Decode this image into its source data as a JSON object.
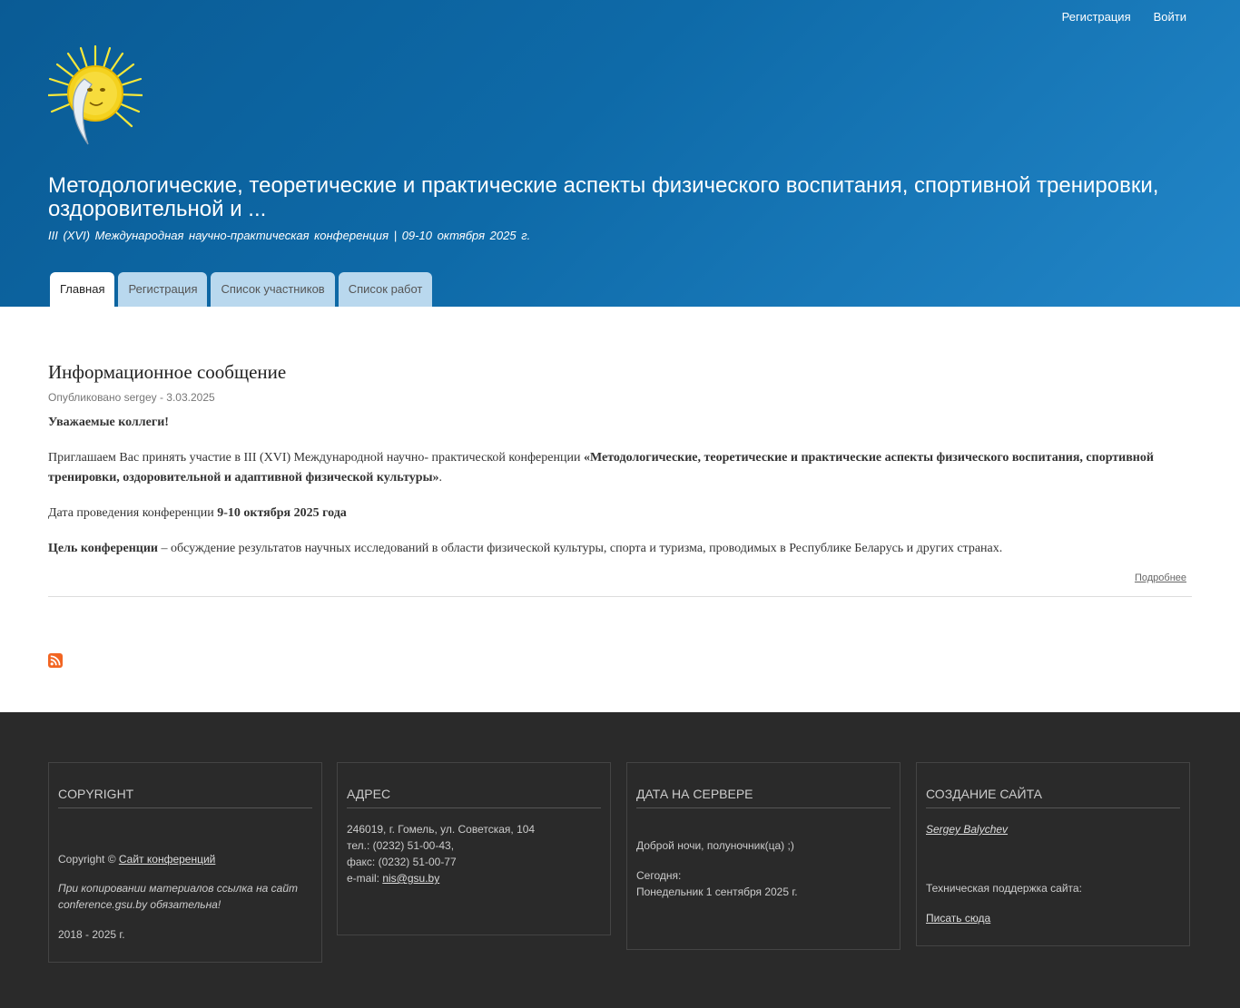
{
  "top_links": {
    "register": "Регистрация",
    "login": "Войти"
  },
  "site": {
    "title": "Методологические, теоретические и практические аспекты физического воспитания, спортивной тренировки, оздоровительной и ...",
    "slogan": "III (XVI) Международная научно-практическая конференция | 09-10 октября 2025 г."
  },
  "tabs": [
    {
      "label": "Главная",
      "active": true
    },
    {
      "label": "Регистрация"
    },
    {
      "label": "Список участников"
    },
    {
      "label": "Список работ"
    }
  ],
  "node": {
    "title": "Информационное сообщение",
    "submitted": "Опубликовано sergey - 3.03.2025",
    "greeting": "Уважаемые коллеги!",
    "invite_text": "Приглашаем Вас принять участие в III (XVI) Международной научно- практической конференции ",
    "invite_bold": "«Методологические, теоретические и практические аспекты физического воспитания, спортивной тренировки, оздоровительной и адаптивной физической культуры»",
    "invite_end": ".",
    "date_text": "Дата проведения конференции ",
    "date_bold": "9-10 октября 2025 года",
    "goal_bold": "Цель конференции",
    "goal_text": " – обсуждение результатов научных исследований в области физической культуры, спорта и туризма, проводимых в Республике Беларусь и других странах.",
    "more": "Подробнее"
  },
  "icons": {
    "rss": "rss-icon",
    "logo": "sun-moon-logo"
  },
  "colors": {
    "header_top": "#0a5b95",
    "header_bottom": "#2286c8",
    "tab_bg": "#b9d8ee",
    "footer_bg": "#2a2a2a",
    "rss": "#f26522"
  },
  "footer": {
    "copyright": {
      "title": "Copyright",
      "line_prefix": "Copyright © ",
      "link": "Сайт конференций",
      "note": "При копировании материалов ссылка на сайт conference.gsu.by обязательна!",
      "years": "2018 - 2025 г."
    },
    "address": {
      "title": "Адрес",
      "street": "246019, г. Гомель, ул. Советская, 104",
      "phone": "тел.: (0232) 51-00-43,",
      "fax": "факс: (0232) 51-00-77",
      "email_label": "e-mail: ",
      "email": "nis@gsu.by"
    },
    "server_date": {
      "title": "Дата на сервере",
      "greeting": "Доброй ночи, полуночник(ца) ;)",
      "today_label": "Сегодня:",
      "today_value": "Понедельник 1 сентября 2025 г."
    },
    "creation": {
      "title": "Создание сайта",
      "author": "Sergey Balychev",
      "support_label": "Техническая поддержка сайта:",
      "support_link": "Писать сюда"
    }
  }
}
